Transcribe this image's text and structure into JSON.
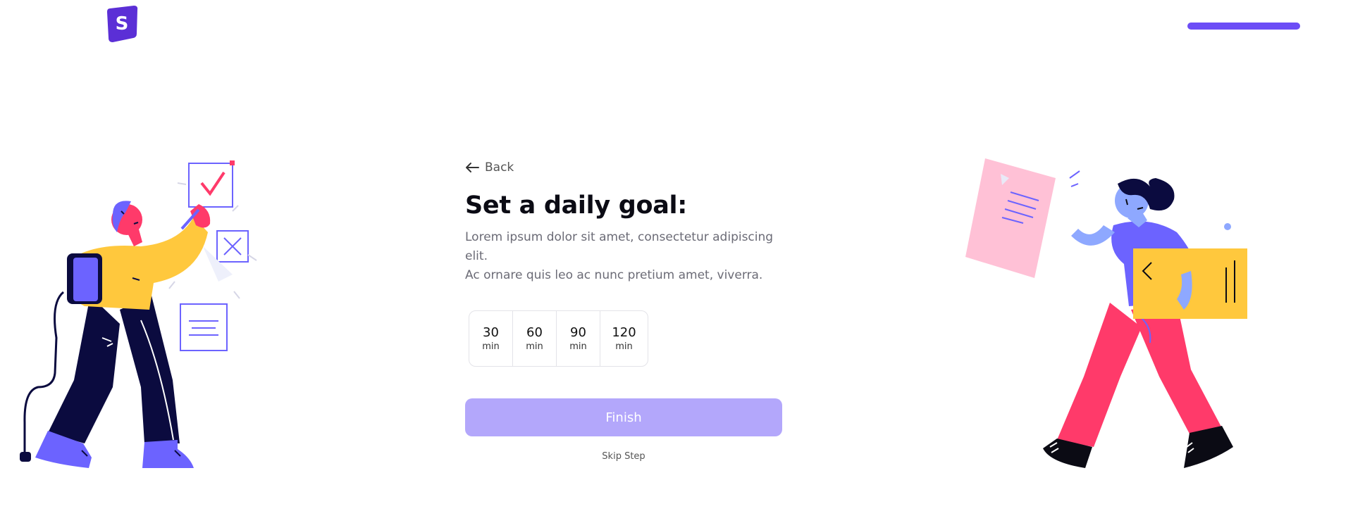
{
  "header": {
    "logo_letter": "S"
  },
  "progress": {
    "value": 1.0
  },
  "main": {
    "back_label": "Back",
    "title": "Set a daily goal:",
    "description_line1": "Lorem ipsum dolor sit amet, consectetur adipiscing elit.",
    "description_line2": "Ac ornare quis leo ac nunc pretium amet, viverra.",
    "goals": [
      {
        "value": "30",
        "unit": "min"
      },
      {
        "value": "60",
        "unit": "min"
      },
      {
        "value": "90",
        "unit": "min"
      },
      {
        "value": "120",
        "unit": "min"
      }
    ],
    "finish_label": "Finish",
    "skip_label": "Skip Step"
  },
  "colors": {
    "accent": "#6c4df6",
    "button": "#b3a7fb",
    "yellow": "#ffc83d",
    "pink": "#ff3a6a",
    "navy": "#0b0b3f"
  }
}
